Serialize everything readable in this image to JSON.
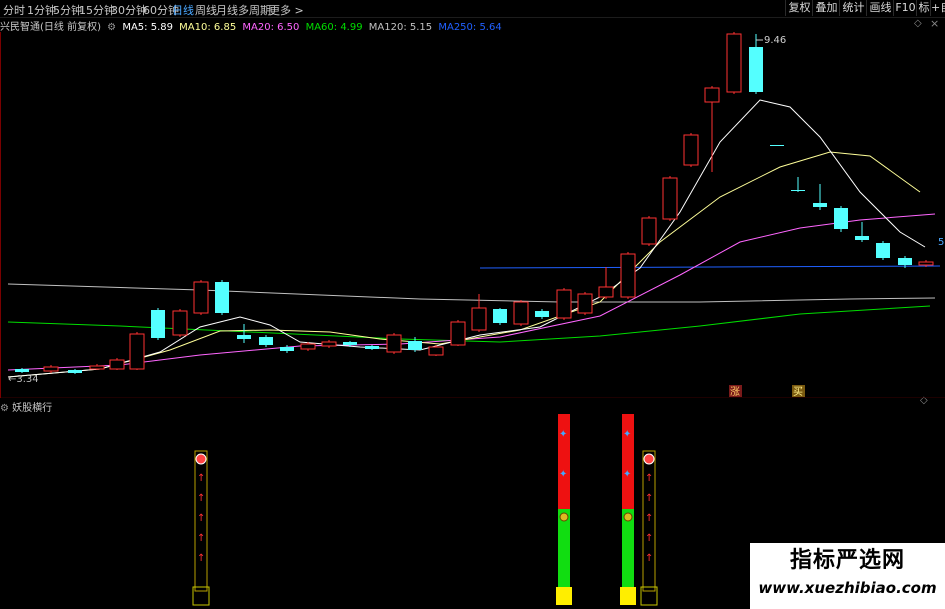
{
  "toolbar": {
    "periods": [
      "分时",
      "1分钟",
      "5分钟",
      "15分钟",
      "30分钟",
      "60分钟",
      "日线",
      "周线",
      "月线",
      "多周期",
      "更多 >"
    ],
    "active_period": "日线",
    "right_buttons": [
      "复权",
      "叠加",
      "统计",
      "画线",
      "F10",
      "标记",
      "+自"
    ]
  },
  "legend": {
    "stock_title": "兴民智通(日线 前复权)",
    "ma5": "MA5: 5.89",
    "ma10": "MA10: 6.85",
    "ma20": "MA20: 6.50",
    "ma60": "MA60: 4.99",
    "ma120": "MA120: 5.15",
    "ma250": "MA250: 5.64"
  },
  "colors": {
    "up": "#ff3232",
    "down": "#54ffff",
    "ma5": "#ffffff",
    "ma10": "#ffff99",
    "ma20": "#ff66ff",
    "ma60": "#00dd00",
    "ma120": "#c0c0c0",
    "ma250": "#2060ff"
  },
  "main_chart": {
    "high_label": "9.46",
    "low_label": "3.34",
    "right_price_label": "5",
    "markers": [
      "涨",
      "买"
    ]
  },
  "sub_panel": {
    "title": "妖股横行"
  },
  "watermark": {
    "title": "指标严选网",
    "url": "www.xuezhibiao.com"
  }
}
